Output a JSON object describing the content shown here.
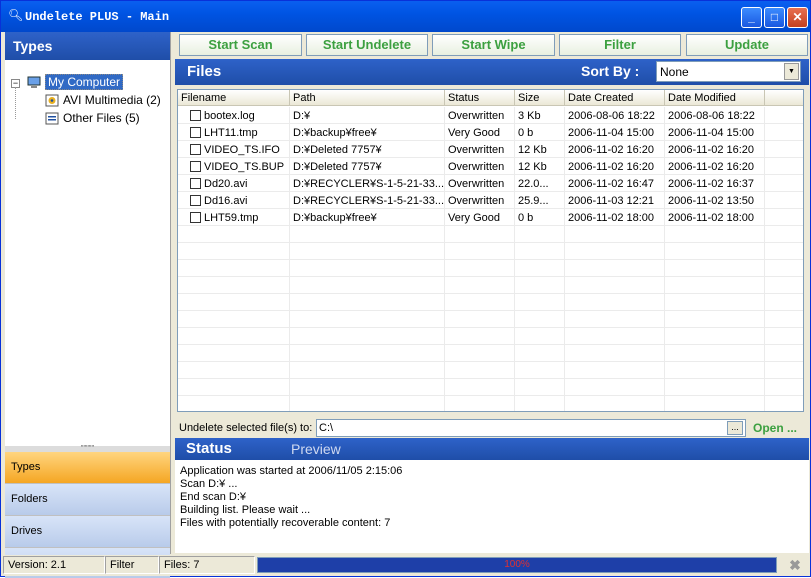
{
  "window": {
    "title": "Undelete PLUS - Main",
    "min": "_",
    "max": "□",
    "close": "✕"
  },
  "left": {
    "header": "Types",
    "tree": [
      {
        "label": "My Computer",
        "icon": "computer-icon"
      },
      {
        "label": "AVI Multimedia (2)",
        "icon": "video-icon"
      },
      {
        "label": "Other Files (5)",
        "icon": "file-icon"
      }
    ],
    "nav": [
      {
        "label": "Types"
      },
      {
        "label": "Folders"
      },
      {
        "label": "Drives"
      }
    ],
    "more": "»"
  },
  "toolbar": {
    "start_scan": "Start Scan",
    "start_undelete": "Start Undelete",
    "start_wipe": "Start Wipe",
    "filter": "Filter",
    "update": "Update"
  },
  "files": {
    "title": "Files",
    "sort_label": "Sort By :",
    "sort_value": "None",
    "columns": [
      "Filename",
      "Path",
      "Status",
      "Size",
      "Date Created",
      "Date Modified"
    ],
    "rows": [
      [
        "bootex.log",
        "D:¥",
        "Overwritten",
        "3 Kb",
        "2006-08-06 18:22",
        "2006-08-06 18:22"
      ],
      [
        "LHT11.tmp",
        "D:¥backup¥free¥",
        "Very Good",
        "0 b",
        "2006-11-04 15:00",
        "2006-11-04 15:00"
      ],
      [
        "VIDEO_TS.IFO",
        "D:¥Deleted 7757¥",
        "Overwritten",
        "12 Kb",
        "2006-11-02 16:20",
        "2006-11-02 16:20"
      ],
      [
        "VIDEO_TS.BUP",
        "D:¥Deleted 7757¥",
        "Overwritten",
        "12 Kb",
        "2006-11-02 16:20",
        "2006-11-02 16:20"
      ],
      [
        "Dd20.avi",
        "D:¥RECYCLER¥S-1-5-21-33...",
        "Overwritten",
        "22.0...",
        "2006-11-02 16:47",
        "2006-11-02 16:37"
      ],
      [
        "Dd16.avi",
        "D:¥RECYCLER¥S-1-5-21-33...",
        "Overwritten",
        "25.9...",
        "2006-11-03 12:21",
        "2006-11-02 13:50"
      ],
      [
        "LHT59.tmp",
        "D:¥backup¥free¥",
        "Very Good",
        "0 b",
        "2006-11-02 18:00",
        "2006-11-02 18:00"
      ]
    ]
  },
  "undelete": {
    "label": "Undelete selected file(s) to:",
    "value": "C:\\",
    "browse": "...",
    "open": "Open ..."
  },
  "status": {
    "tab_status": "Status",
    "tab_preview": "Preview",
    "log": [
      "Application was started at 2006/11/05 2:15:06",
      "Scan D:¥ ...",
      "End scan D:¥",
      "Building list. Please wait ...",
      "Files with potentially recoverable content: 7"
    ]
  },
  "statusbar": {
    "version": "Version: 2.1",
    "filter": "Filter",
    "files": "Files: 7",
    "progress": "100%",
    "progress_value": 1.0
  },
  "colors": {
    "accent": "#1f4ea8",
    "button_text": "#3ca040",
    "selected_nav": "#f5a623"
  }
}
